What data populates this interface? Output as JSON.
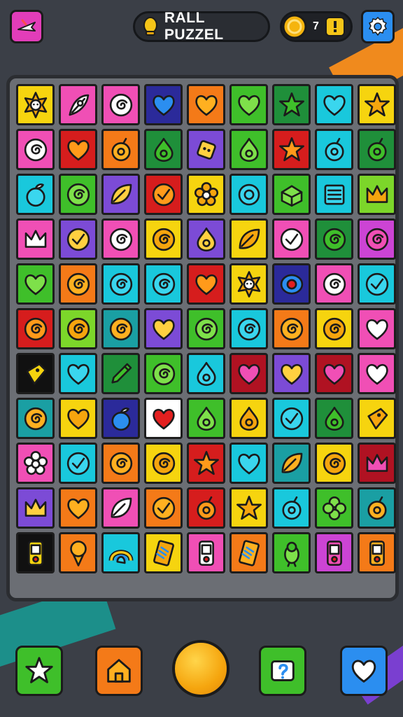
{
  "app": {
    "title": "RALL PUZZEL"
  },
  "header": {
    "coins": "7",
    "menu_icon": "plane-icon",
    "settings_icon": "gear-icon",
    "title_icon": "trophy-icon",
    "coin_icon": "coin-icon",
    "add_coins_icon": "exclamation-icon"
  },
  "colors": {
    "background": "#3b3f47",
    "board_frame": "#6b6e74",
    "menu_button": "#e23db9",
    "settings_button": "#2b8ef0",
    "coin": "#f5c518"
  },
  "palette": {
    "Y": "#f6d40f",
    "P": "#f04fb5",
    "M": "#cc44d4",
    "N": "#2b2a9a",
    "O": "#f47a18",
    "G": "#3fbf2a",
    "C": "#19c8dc",
    "R": "#d61d1d",
    "V": "#7c4bd6",
    "T": "#1a9fa3",
    "L": "#7cd62a",
    "D": "#1f8f3a",
    "K": "#111111",
    "W": "#ffffff",
    "B": "#2f7ee0",
    "X": "#b01222"
  },
  "board": {
    "rows": 11,
    "cols": 9,
    "tiles": [
      [
        {
          "c": "Y",
          "i": "flower-face-icon"
        },
        {
          "c": "P",
          "i": "feather-icon"
        },
        {
          "c": "P",
          "i": "swirl-icon"
        },
        {
          "c": "N",
          "i": "heart-icon"
        },
        {
          "c": "O",
          "i": "heart-icon"
        },
        {
          "c": "G",
          "i": "heart-icon"
        },
        {
          "c": "D",
          "i": "star-icon"
        },
        {
          "c": "C",
          "i": "heart-icon"
        },
        {
          "c": "Y",
          "i": "star-icon"
        }
      ],
      [
        {
          "c": "P",
          "i": "swirl-icon"
        },
        {
          "c": "R",
          "i": "heart-icon"
        },
        {
          "c": "O",
          "i": "bomb-icon"
        },
        {
          "c": "D",
          "i": "drop-icon"
        },
        {
          "c": "V",
          "i": "robot-icon"
        },
        {
          "c": "G",
          "i": "drop-icon"
        },
        {
          "c": "R",
          "i": "star-icon"
        },
        {
          "c": "C",
          "i": "bomb-icon"
        },
        {
          "c": "D",
          "i": "bomb-icon"
        }
      ],
      [
        {
          "c": "C",
          "i": "fruit-icon"
        },
        {
          "c": "G",
          "i": "swirl-icon"
        },
        {
          "c": "V",
          "i": "leaf-icon"
        },
        {
          "c": "R",
          "i": "check-icon"
        },
        {
          "c": "Y",
          "i": "flower-icon"
        },
        {
          "c": "C",
          "i": "ring-icon"
        },
        {
          "c": "G",
          "i": "box-icon"
        },
        {
          "c": "C",
          "i": "book-icon"
        },
        {
          "c": "L",
          "i": "crown-icon"
        }
      ],
      [
        {
          "c": "P",
          "i": "crown-icon"
        },
        {
          "c": "V",
          "i": "check-icon"
        },
        {
          "c": "P",
          "i": "swirl-icon"
        },
        {
          "c": "Y",
          "i": "swirl-icon"
        },
        {
          "c": "V",
          "i": "drop-icon"
        },
        {
          "c": "Y",
          "i": "leaf-icon"
        },
        {
          "c": "P",
          "i": "check-icon"
        },
        {
          "c": "D",
          "i": "swirl-icon"
        },
        {
          "c": "M",
          "i": "swirl-icon"
        }
      ],
      [
        {
          "c": "G",
          "i": "heart-icon"
        },
        {
          "c": "O",
          "i": "swirl-icon"
        },
        {
          "c": "C",
          "i": "swirl-icon"
        },
        {
          "c": "C",
          "i": "swirl-icon"
        },
        {
          "c": "R",
          "i": "heart-icon"
        },
        {
          "c": "Y",
          "i": "flower-face-icon"
        },
        {
          "c": "N",
          "i": "eye-icon"
        },
        {
          "c": "P",
          "i": "swirl-icon"
        },
        {
          "c": "C",
          "i": "check-icon"
        }
      ],
      [
        {
          "c": "R",
          "i": "swirl-icon"
        },
        {
          "c": "L",
          "i": "swirl-icon"
        },
        {
          "c": "T",
          "i": "swirl-icon"
        },
        {
          "c": "V",
          "i": "heart-icon"
        },
        {
          "c": "G",
          "i": "swirl-icon"
        },
        {
          "c": "C",
          "i": "swirl-icon"
        },
        {
          "c": "O",
          "i": "swirl-icon"
        },
        {
          "c": "Y",
          "i": "swirl-icon"
        },
        {
          "c": "P",
          "i": "heart-icon"
        }
      ],
      [
        {
          "c": "K",
          "i": "bag-icon"
        },
        {
          "c": "C",
          "i": "heart-icon"
        },
        {
          "c": "D",
          "i": "pencil-icon"
        },
        {
          "c": "G",
          "i": "swirl-icon"
        },
        {
          "c": "C",
          "i": "drop-icon"
        },
        {
          "c": "X",
          "i": "heart-icon"
        },
        {
          "c": "V",
          "i": "heart-icon"
        },
        {
          "c": "X",
          "i": "heart-icon"
        },
        {
          "c": "P",
          "i": "heart-icon"
        }
      ],
      [
        {
          "c": "T",
          "i": "swirl-icon"
        },
        {
          "c": "Y",
          "i": "heart-icon"
        },
        {
          "c": "N",
          "i": "fruit-icon"
        },
        {
          "c": "W",
          "i": "heart-icon"
        },
        {
          "c": "G",
          "i": "drop-icon"
        },
        {
          "c": "Y",
          "i": "drop-icon"
        },
        {
          "c": "C",
          "i": "check-icon"
        },
        {
          "c": "D",
          "i": "drop-icon"
        },
        {
          "c": "Y",
          "i": "bag-icon"
        }
      ],
      [
        {
          "c": "P",
          "i": "flower-icon"
        },
        {
          "c": "C",
          "i": "check-icon"
        },
        {
          "c": "O",
          "i": "swirl-icon"
        },
        {
          "c": "Y",
          "i": "swirl-icon"
        },
        {
          "c": "R",
          "i": "star-icon"
        },
        {
          "c": "C",
          "i": "heart-icon"
        },
        {
          "c": "T",
          "i": "leaf-icon"
        },
        {
          "c": "Y",
          "i": "swirl-icon"
        },
        {
          "c": "X",
          "i": "crown-icon"
        }
      ],
      [
        {
          "c": "V",
          "i": "crown-icon"
        },
        {
          "c": "O",
          "i": "heart-icon"
        },
        {
          "c": "P",
          "i": "leaf-icon"
        },
        {
          "c": "O",
          "i": "check-icon"
        },
        {
          "c": "R",
          "i": "bomb-icon"
        },
        {
          "c": "Y",
          "i": "star-icon"
        },
        {
          "c": "C",
          "i": "bomb-icon"
        },
        {
          "c": "G",
          "i": "clover-icon"
        },
        {
          "c": "T",
          "i": "bomb-icon"
        }
      ],
      [
        {
          "c": "K",
          "i": "phone-icon"
        },
        {
          "c": "O",
          "i": "icecream-icon"
        },
        {
          "c": "C",
          "i": "rainbow-icon"
        },
        {
          "c": "Y",
          "i": "card-icon"
        },
        {
          "c": "P",
          "i": "phone-icon"
        },
        {
          "c": "O",
          "i": "card-icon"
        },
        {
          "c": "G",
          "i": "bird-icon"
        },
        {
          "c": "M",
          "i": "phone-icon"
        },
        {
          "c": "O",
          "i": "phone-icon"
        }
      ]
    ]
  },
  "bottom_bar": [
    {
      "name": "star-button",
      "icon": "star-icon",
      "color": "#3fbf2a"
    },
    {
      "name": "shop-button",
      "icon": "house-icon",
      "color": "#f47a18"
    },
    {
      "name": "play-coin-button",
      "icon": "coin-icon",
      "color": "#f5a50e"
    },
    {
      "name": "hint-button",
      "icon": "question-icon",
      "color": "#3fbf2a"
    },
    {
      "name": "lives-button",
      "icon": "heart-icon",
      "color": "#2b8ef0"
    }
  ]
}
